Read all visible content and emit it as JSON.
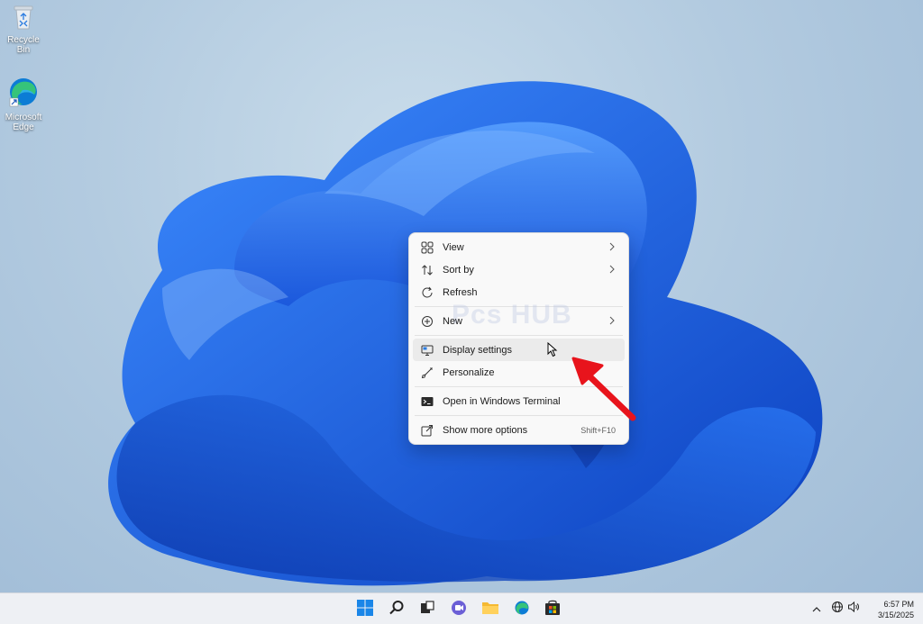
{
  "desktop": {
    "icons": [
      {
        "label": "Recycle Bin",
        "icon": "recycle-bin-icon"
      },
      {
        "label": "Microsoft Edge",
        "icon": "edge-icon"
      }
    ]
  },
  "context_menu": {
    "watermark": "Pcs HUB",
    "items": [
      {
        "label": "View",
        "icon": "grid-icon",
        "submenu": true
      },
      {
        "label": "Sort by",
        "icon": "sort-icon",
        "submenu": true
      },
      {
        "label": "Refresh",
        "icon": "refresh-icon"
      },
      {
        "label": "New",
        "icon": "plus-circle-icon",
        "submenu": true
      },
      {
        "label": "Display settings",
        "icon": "display-icon",
        "highlighted": true
      },
      {
        "label": "Personalize",
        "icon": "brush-icon"
      },
      {
        "label": "Open in Windows Terminal",
        "icon": "terminal-icon"
      },
      {
        "label": "Show more options",
        "icon": "share-icon",
        "shortcut": "Shift+F10"
      }
    ]
  },
  "taskbar": {
    "apps": [
      "start-icon",
      "search-icon",
      "task-view-icon",
      "chat-icon",
      "file-explorer-icon",
      "edge-icon",
      "store-icon"
    ],
    "tray": [
      "chevron-up-icon",
      "network-icon",
      "volume-icon"
    ],
    "time": "6:57 PM",
    "date": "3/15/2025"
  },
  "colors": {
    "accent": "#0067c0",
    "annotation_arrow": "#e8141c",
    "wallpaper_bloom": "#1f6ff0"
  }
}
